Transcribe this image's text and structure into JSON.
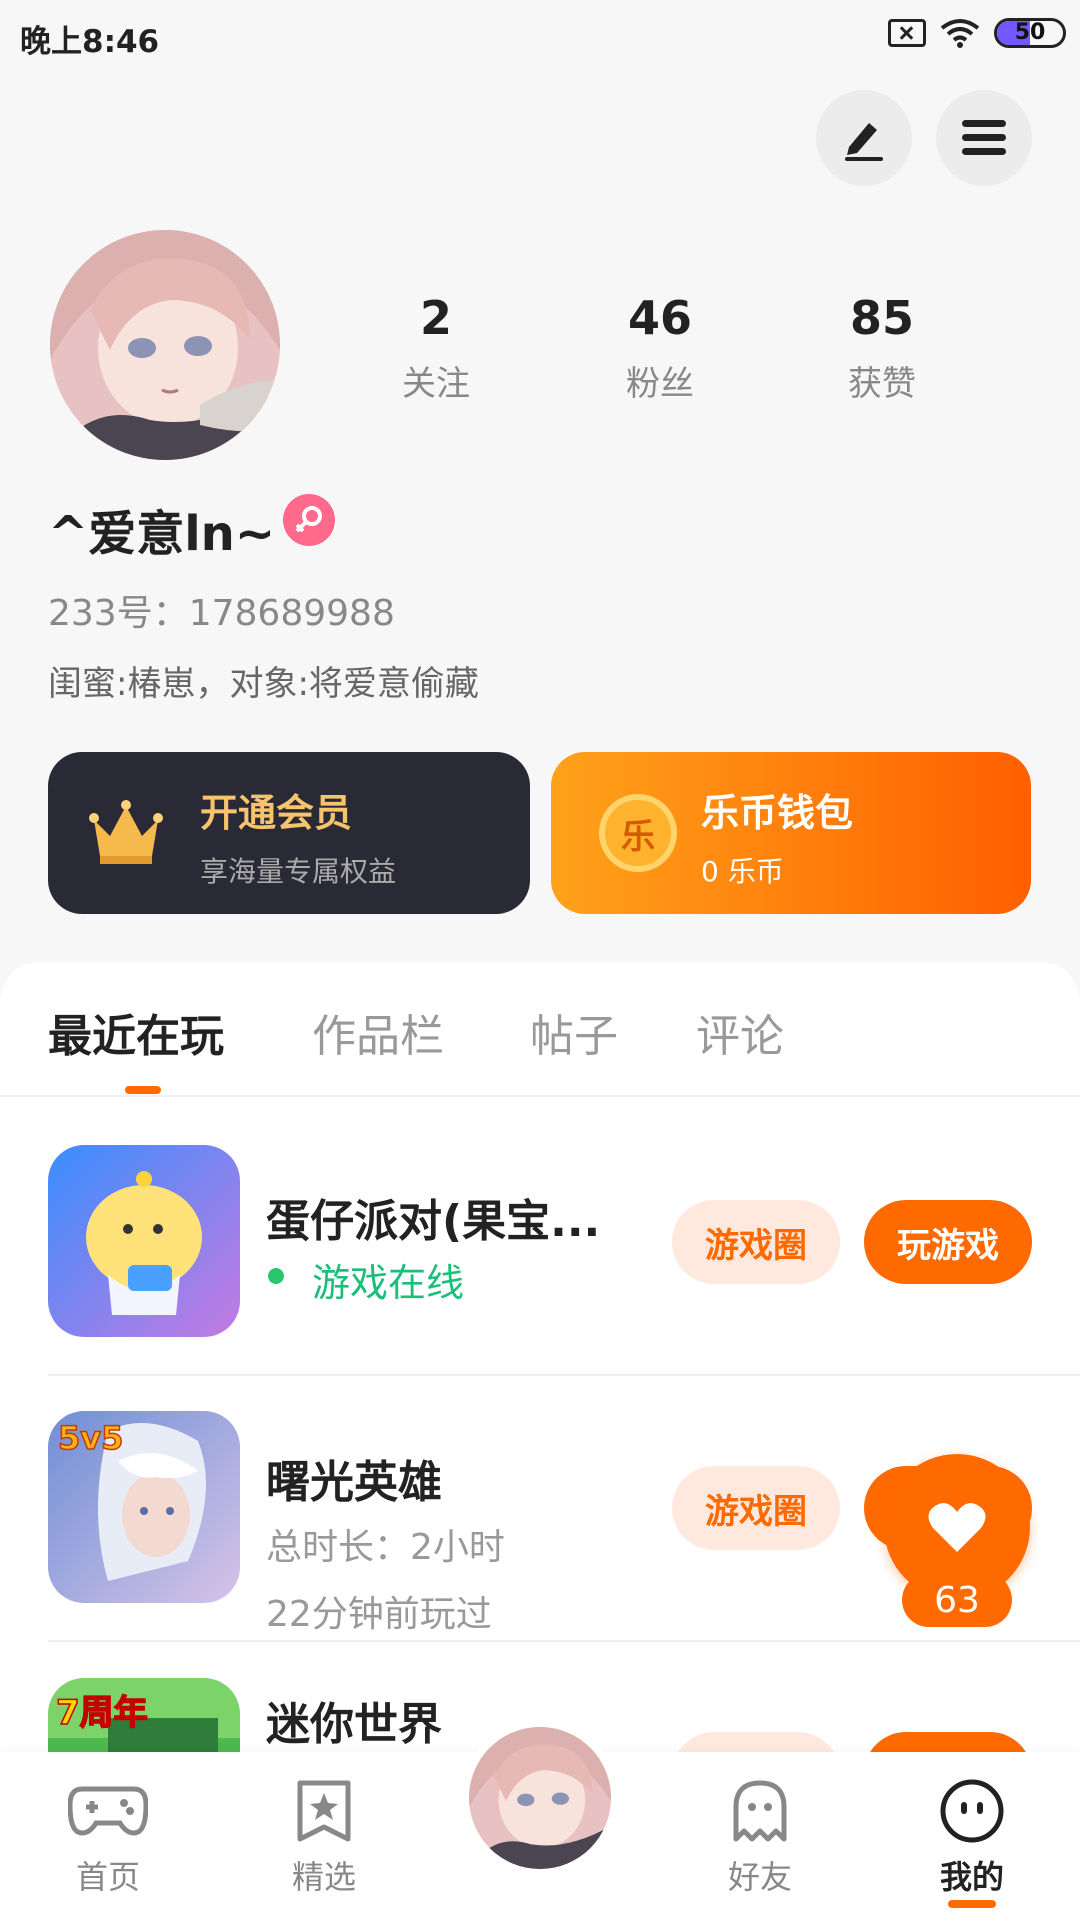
{
  "status_bar": {
    "time": "晚上8:46",
    "battery_level": "50",
    "battery_fraction": 0.5,
    "icons": [
      "sim-off-icon",
      "wifi-icon",
      "battery-icon"
    ]
  },
  "header": {
    "edit_icon": "pen-icon",
    "menu_icon": "hamburger-menu-icon"
  },
  "profile": {
    "avatar": "anime-avatar",
    "stats": [
      {
        "value": "2",
        "label": "关注"
      },
      {
        "value": "46",
        "label": "粉丝"
      },
      {
        "value": "85",
        "label": "获赞"
      }
    ],
    "nickname": "^爱意ln~",
    "gender_icon": "female-icon",
    "account_id": "233号：178689988",
    "bio": "闺蜜:椿崽，对象:将爱意偷藏"
  },
  "cards": {
    "vip": {
      "title": "开通会员",
      "subtitle": "享海量专属权益",
      "icon": "crown-icon"
    },
    "wallet": {
      "title": "乐币钱包",
      "subtitle": "0 乐币",
      "coin_char": "乐"
    }
  },
  "tabs": [
    {
      "label": "最近在玩",
      "active": true
    },
    {
      "label": "作品栏",
      "active": false
    },
    {
      "label": "帖子",
      "active": false
    },
    {
      "label": "评论",
      "active": false
    }
  ],
  "games": [
    {
      "title": "蛋仔派对(果宝...",
      "status": "游戏在线",
      "circle_label": "游戏圈",
      "play_label": "玩游戏"
    },
    {
      "title": "曙光英雄",
      "duration": "总时长：2小时",
      "last_played": "22分钟前玩过",
      "badge": "5v5",
      "circle_label": "游戏圈"
    },
    {
      "title": "迷你世界",
      "badge": "7周年"
    }
  ],
  "like_fab": {
    "count": "63",
    "icon": "heart-icon"
  },
  "bottom_nav": [
    {
      "label": "首页",
      "icon": "gamepad-icon"
    },
    {
      "label": "精选",
      "icon": "star-card-icon"
    },
    {
      "label": "好友",
      "icon": "ghost-icon"
    },
    {
      "label": "我的",
      "icon": "smiley-icon",
      "active": true
    }
  ],
  "colors": {
    "accent": "#ff6a00",
    "online": "#1bbf7a",
    "vip_bg": "#2a2a36",
    "vip_text": "#f7c46c"
  }
}
